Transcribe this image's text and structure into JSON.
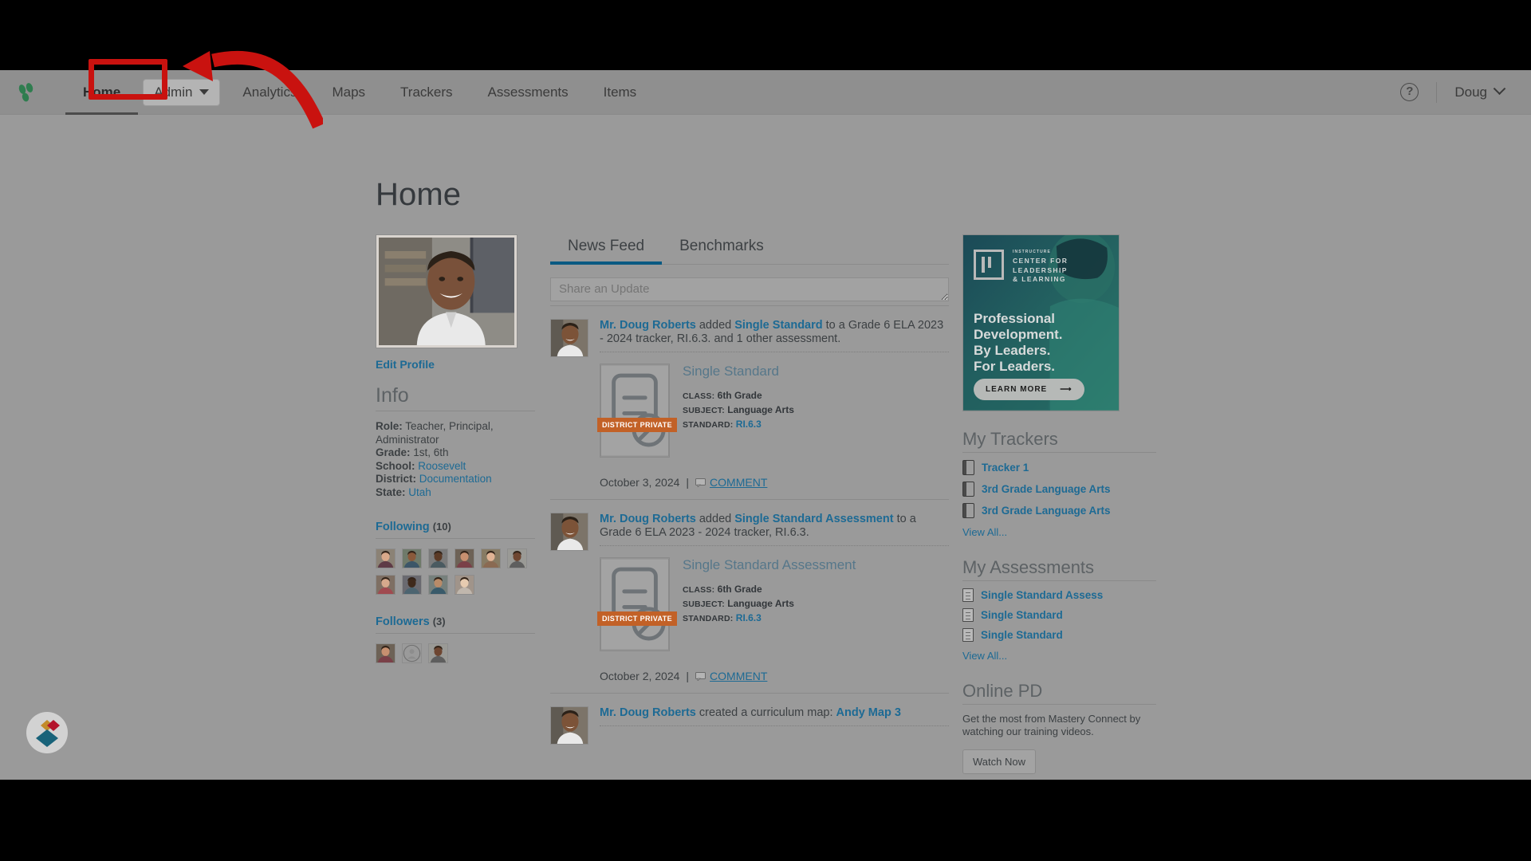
{
  "nav": {
    "logo": "masteryconnect-logo",
    "items": [
      {
        "label": "Home",
        "active": true
      },
      {
        "label": "Admin",
        "type": "dropdown"
      },
      {
        "label": "Analytics"
      },
      {
        "label": "Maps"
      },
      {
        "label": "Trackers"
      },
      {
        "label": "Assessments"
      },
      {
        "label": "Items"
      }
    ],
    "help_icon": "help-circle-icon",
    "user_name": "Doug"
  },
  "annotation": {
    "highlight_target": "Admin",
    "color": "#c9120f",
    "shape": "arrow-pointing-left-to-admin-button"
  },
  "page": {
    "title": "Home"
  },
  "profile": {
    "photo": "headshot-doug-roberts",
    "edit_link": "Edit Profile",
    "info_heading": "Info",
    "info": [
      {
        "key": "Role:",
        "value": "Teacher, Principal, Administrator",
        "link": false
      },
      {
        "key": "Grade:",
        "value": "1st, 6th",
        "link": false
      },
      {
        "key": "School:",
        "value": "Roosevelt",
        "link": true
      },
      {
        "key": "District:",
        "value": "Documentation",
        "link": true
      },
      {
        "key": "State:",
        "value": "Utah",
        "link": true
      }
    ],
    "following_label": "Following",
    "following_count": "(10)",
    "following_avatars": 10,
    "followers_label": "Followers",
    "followers_count": "(3)",
    "followers_avatars": 3
  },
  "feed": {
    "tabs": [
      {
        "label": "News Feed",
        "active": true
      },
      {
        "label": "Benchmarks",
        "active": false
      }
    ],
    "share_placeholder": "Share an Update",
    "comment_label": "COMMENT",
    "posts": [
      {
        "author": "Mr. Doug Roberts",
        "action_pre": " added ",
        "object": "Single Standard",
        "action_post": " to a Grade 6 ELA 2023 - 2024 tracker, RI.6.3. and 1 other assessment.",
        "card": {
          "title": "Single Standard",
          "badge": "DISTRICT PRIVATE",
          "class_key": "CLASS:",
          "class_value": "6th Grade",
          "subject_key": "SUBJECT:",
          "subject_value": "Language Arts",
          "standard_key": "STANDARD:",
          "standard_value": "RI.6.3"
        },
        "date": "October 3, 2024"
      },
      {
        "author": "Mr. Doug Roberts",
        "action_pre": " added ",
        "object": "Single Standard Assessment",
        "action_post": " to a Grade 6 ELA 2023 - 2024 tracker, RI.6.3.",
        "card": {
          "title": "Single Standard Assessment",
          "badge": "DISTRICT PRIVATE",
          "class_key": "CLASS:",
          "class_value": "6th Grade",
          "subject_key": "SUBJECT:",
          "subject_value": "Language Arts",
          "standard_key": "STANDARD:",
          "standard_value": "RI.6.3"
        },
        "date": "October 2, 2024"
      },
      {
        "author": "Mr. Doug Roberts",
        "action_pre": " created a curriculum map: ",
        "object": "Andy Map 3",
        "action_post": "",
        "card": null,
        "date": ""
      }
    ]
  },
  "promo": {
    "brand_tiny": "INSTRUCTURE",
    "brand_line1": "CENTER FOR",
    "brand_line2": "LEADERSHIP",
    "brand_line3": "& LEARNING",
    "headline": "Professional\nDevelopment.\nBy Leaders.\nFor Leaders.",
    "cta": "LEARN MORE",
    "accent": "#1f5d62"
  },
  "trackers": {
    "heading": "My Trackers",
    "items": [
      "Tracker 1",
      "3rd Grade Language Arts",
      "3rd Grade Language Arts"
    ],
    "view_all": "View All..."
  },
  "assessments": {
    "heading": "My Assessments",
    "items": [
      "Single Standard Assess",
      "Single Standard",
      "Single Standard"
    ],
    "view_all": "View All..."
  },
  "online_pd": {
    "heading": "Online PD",
    "body": "Get the most from Mastery Connect by watching our training videos.",
    "button": "Watch Now"
  },
  "colors": {
    "link": "#1d6a94",
    "tab_underline": "#0a5a82",
    "badge_orange": "#c26127",
    "annotation_red": "#c9120f"
  }
}
